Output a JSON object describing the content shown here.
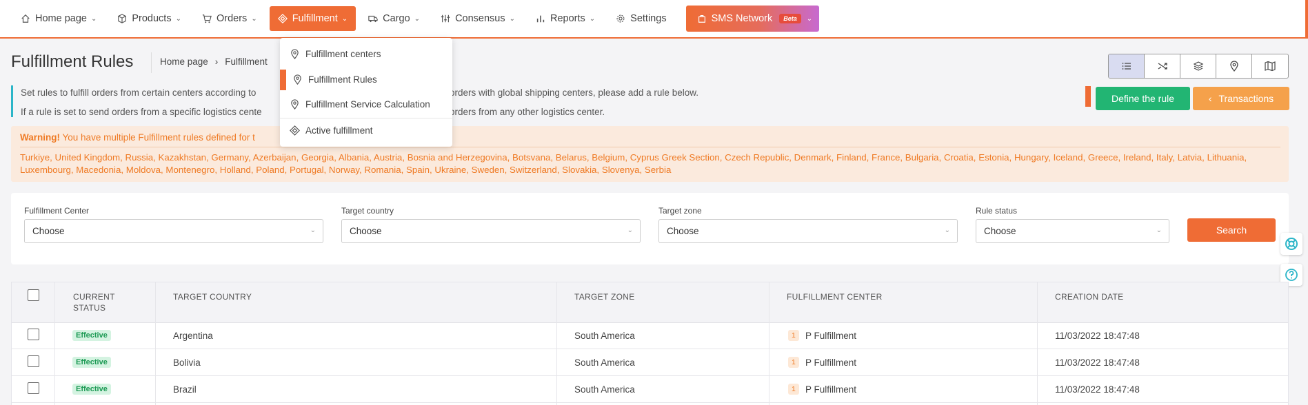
{
  "nav": {
    "items": [
      {
        "label": "Home page",
        "icon": "home-icon"
      },
      {
        "label": "Products",
        "icon": "box-icon"
      },
      {
        "label": "Orders",
        "icon": "cart-icon"
      },
      {
        "label": "Fulfillment",
        "icon": "fulfillment-icon",
        "active": true
      },
      {
        "label": "Cargo",
        "icon": "truck-icon"
      },
      {
        "label": "Consensus",
        "icon": "sliders-icon"
      },
      {
        "label": "Reports",
        "icon": "bar-chart-icon"
      },
      {
        "label": "Settings",
        "icon": "gear-icon"
      }
    ],
    "sms": {
      "label": "SMS Network",
      "badge": "Beta"
    }
  },
  "dropdown": {
    "items": [
      {
        "label": "Fulfillment centers"
      },
      {
        "label": "Fulfillment Rules"
      },
      {
        "label": "Fulfillment Service Calculation"
      },
      {
        "label": "Active fulfillment"
      }
    ]
  },
  "page": {
    "title": "Fulfillment Rules",
    "breadcrumb": [
      "Home page",
      "›",
      "Fulfillment"
    ]
  },
  "info": {
    "line1_start": "Set rules to fulfill orders from certain centers according to",
    "line1_end": "orders with global shipping centers, please add a rule below.",
    "line2_start": "If a rule is set to send orders from a specific logistics cente",
    "line2_end": "orders from any other logistics center."
  },
  "actions": {
    "define": "Define the rule",
    "transactions": "Transactions",
    "transactions_icon": "‹"
  },
  "warning": {
    "strong": "Warning!",
    "text": "You have multiple Fulfillment rules defined for t",
    "countries": "Turkiye, United Kingdom, Russia, Kazakhstan, Germany, Azerbaijan, Georgia, Albania, Austria, Bosnia and Herzegovina, Botsvana, Belarus, Belgium, Cyprus Greek Section, Czech Republic, Denmark, Finland, France, Bulgaria, Croatia, Estonia, Hungary, Iceland, Greece, Ireland, Italy, Latvia, Lithuania, Luxembourg, Macedonia, Moldova, Montenegro, Holland, Poland, Portugal, Norway, Romania, Spain, Ukraine, Sweden, Switzerland, Slovakia, Slovenya, Serbia"
  },
  "filters": {
    "center": {
      "label": "Fulfillment Center",
      "value": "Choose"
    },
    "country": {
      "label": "Target country",
      "value": "Choose"
    },
    "zone": {
      "label": "Target zone",
      "value": "Choose"
    },
    "status": {
      "label": "Rule status",
      "value": "Choose"
    },
    "search": "Search"
  },
  "table": {
    "headers": {
      "status_line1": "CURRENT",
      "status_line2": "STATUS",
      "country": "TARGET COUNTRY",
      "zone": "TARGET ZONE",
      "center": "FULFILLMENT CENTER",
      "date": "CREATION DATE"
    },
    "rows": [
      {
        "status": "Effective",
        "country": "Argentina",
        "zone": "South America",
        "center_count": "1",
        "center": "P Fulfillment",
        "date": "11/03/2022 18:47:48"
      },
      {
        "status": "Effective",
        "country": "Bolivia",
        "zone": "South America",
        "center_count": "1",
        "center": "P Fulfillment",
        "date": "11/03/2022 18:47:48"
      },
      {
        "status": "Effective",
        "country": "Brazil",
        "zone": "South America",
        "center_count": "1",
        "center": "P Fulfillment",
        "date": "11/03/2022 18:47:48"
      }
    ]
  },
  "colors": {
    "accent": "#ef6c35",
    "success": "#22b573",
    "warning": "#f5a14b"
  }
}
